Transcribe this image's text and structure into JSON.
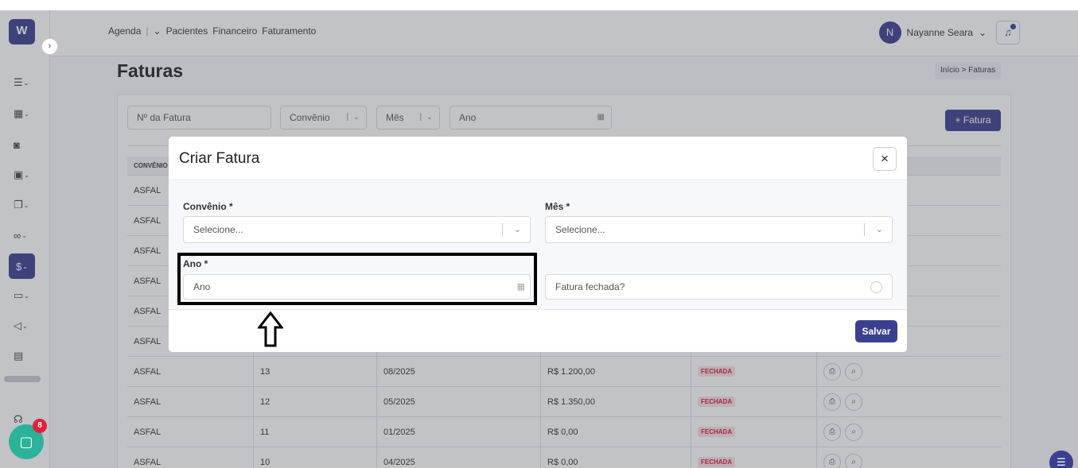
{
  "logo": {
    "text": "W"
  },
  "sidebar": {
    "toggle_glyph": "›",
    "items": [
      "tasks",
      "calendar",
      "patient",
      "clinic",
      "documents",
      "reports",
      "finance",
      "monitor",
      "marketing",
      "notes"
    ]
  },
  "topnav": {
    "items": [
      "Agenda",
      "Pacientes",
      "Financeiro",
      "Faturamento"
    ]
  },
  "user": {
    "initial": "N",
    "name": "Nayanne Seara"
  },
  "page": {
    "title": "Faturas",
    "breadcrumb": "Início > Faturas"
  },
  "filters": {
    "invoice_number_placeholder": "Nº da Fatura",
    "convenio_label": "Convênio",
    "mes_label": "Mês",
    "ano_placeholder": "Ano",
    "add_button_label": "+ Fatura"
  },
  "table": {
    "header": [
      "CONVÊNIO"
    ],
    "rows": [
      {
        "convenio": "ASFAL",
        "numero": "",
        "mes": "",
        "valor": "",
        "status": ""
      },
      {
        "convenio": "ASFAL",
        "numero": "",
        "mes": "",
        "valor": "",
        "status": ""
      },
      {
        "convenio": "ASFAL",
        "numero": "",
        "mes": "",
        "valor": "",
        "status": ""
      },
      {
        "convenio": "ASFAL",
        "numero": "",
        "mes": "",
        "valor": "",
        "status": ""
      },
      {
        "convenio": "ASFAL",
        "numero": "",
        "mes": "",
        "valor": "",
        "status": ""
      },
      {
        "convenio": "ASFAL",
        "numero": "",
        "mes": "",
        "valor": "",
        "status": ""
      },
      {
        "convenio": "ASFAL",
        "numero": "13",
        "mes": "08/2025",
        "valor": "R$ 1.200,00",
        "status": "FECHADA"
      },
      {
        "convenio": "ASFAL",
        "numero": "12",
        "mes": "05/2025",
        "valor": "R$ 1.350,00",
        "status": "FECHADA"
      },
      {
        "convenio": "ASFAL",
        "numero": "11",
        "mes": "01/2025",
        "valor": "R$ 0,00",
        "status": "FECHADA"
      },
      {
        "convenio": "ASFAL",
        "numero": "10",
        "mes": "04/2025",
        "valor": "R$ 0,00",
        "status": "FECHADA"
      }
    ]
  },
  "modal": {
    "title": "Criar Fatura",
    "close_glyph": "×",
    "convenio_label": "Convênio *",
    "convenio_placeholder": "Selecione...",
    "mes_label": "Mês *",
    "mes_placeholder": "Selecione...",
    "ano_label": "Ano *",
    "ano_placeholder": "Ano",
    "fatura_fechada_label": "Fatura fechada?",
    "save_label": "Salvar"
  },
  "chat": {
    "badge_count": "8"
  },
  "colors": {
    "brand": "#3b3f8f",
    "status_closed": "#d11a3a",
    "annotation": "#000000"
  }
}
